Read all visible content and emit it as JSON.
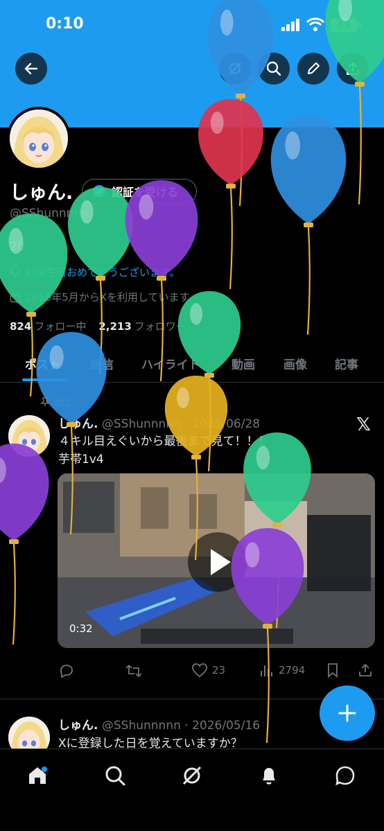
{
  "status_bar": {
    "time": "0:10",
    "battery": "35"
  },
  "profile": {
    "name": "しゅん.",
    "verify_button": "認証を受ける",
    "handle": "@SShunnnnn",
    "bio": "20",
    "birthday": "お誕生日おめでとうございます。",
    "joined": "2016年5月からXを利用しています",
    "following_count": "824",
    "following_label": "フォロー中",
    "followers_count": "2,213",
    "followers_label": "フォロワー"
  },
  "tabs": [
    "ポスト",
    "返信",
    "ハイライト",
    "動画",
    "画像",
    "記事"
  ],
  "pinned_post": {
    "pinned_label": "固定",
    "author": "しゅん.",
    "meta": "@SShunnnnn · 2025/06/28",
    "text_line1": "４キル目えぐいから最後まで見て！！！",
    "text_line2": "芋帯1v4",
    "video_duration": "0:32",
    "likes": "23",
    "views": "2794"
  },
  "second_post": {
    "author": "しゅん.",
    "meta": "@SShunnnnn · 2026/05/16",
    "text": "Xに登録した日を覚えていますか？"
  },
  "colors": {
    "accent": "#1d9bf0",
    "background": "#000000",
    "muted": "#71767b"
  },
  "icons": [
    "back-arrow-icon",
    "grok-icon",
    "search-icon",
    "edit-icon",
    "share-icon",
    "verified-badge-icon",
    "balloon-icon",
    "calendar-icon",
    "pin-icon",
    "x-logo-icon",
    "play-icon",
    "reply-icon",
    "repost-icon",
    "like-icon",
    "views-icon",
    "bookmark-icon",
    "compose-plus-icon",
    "home-icon",
    "bell-icon",
    "messages-icon"
  ]
}
